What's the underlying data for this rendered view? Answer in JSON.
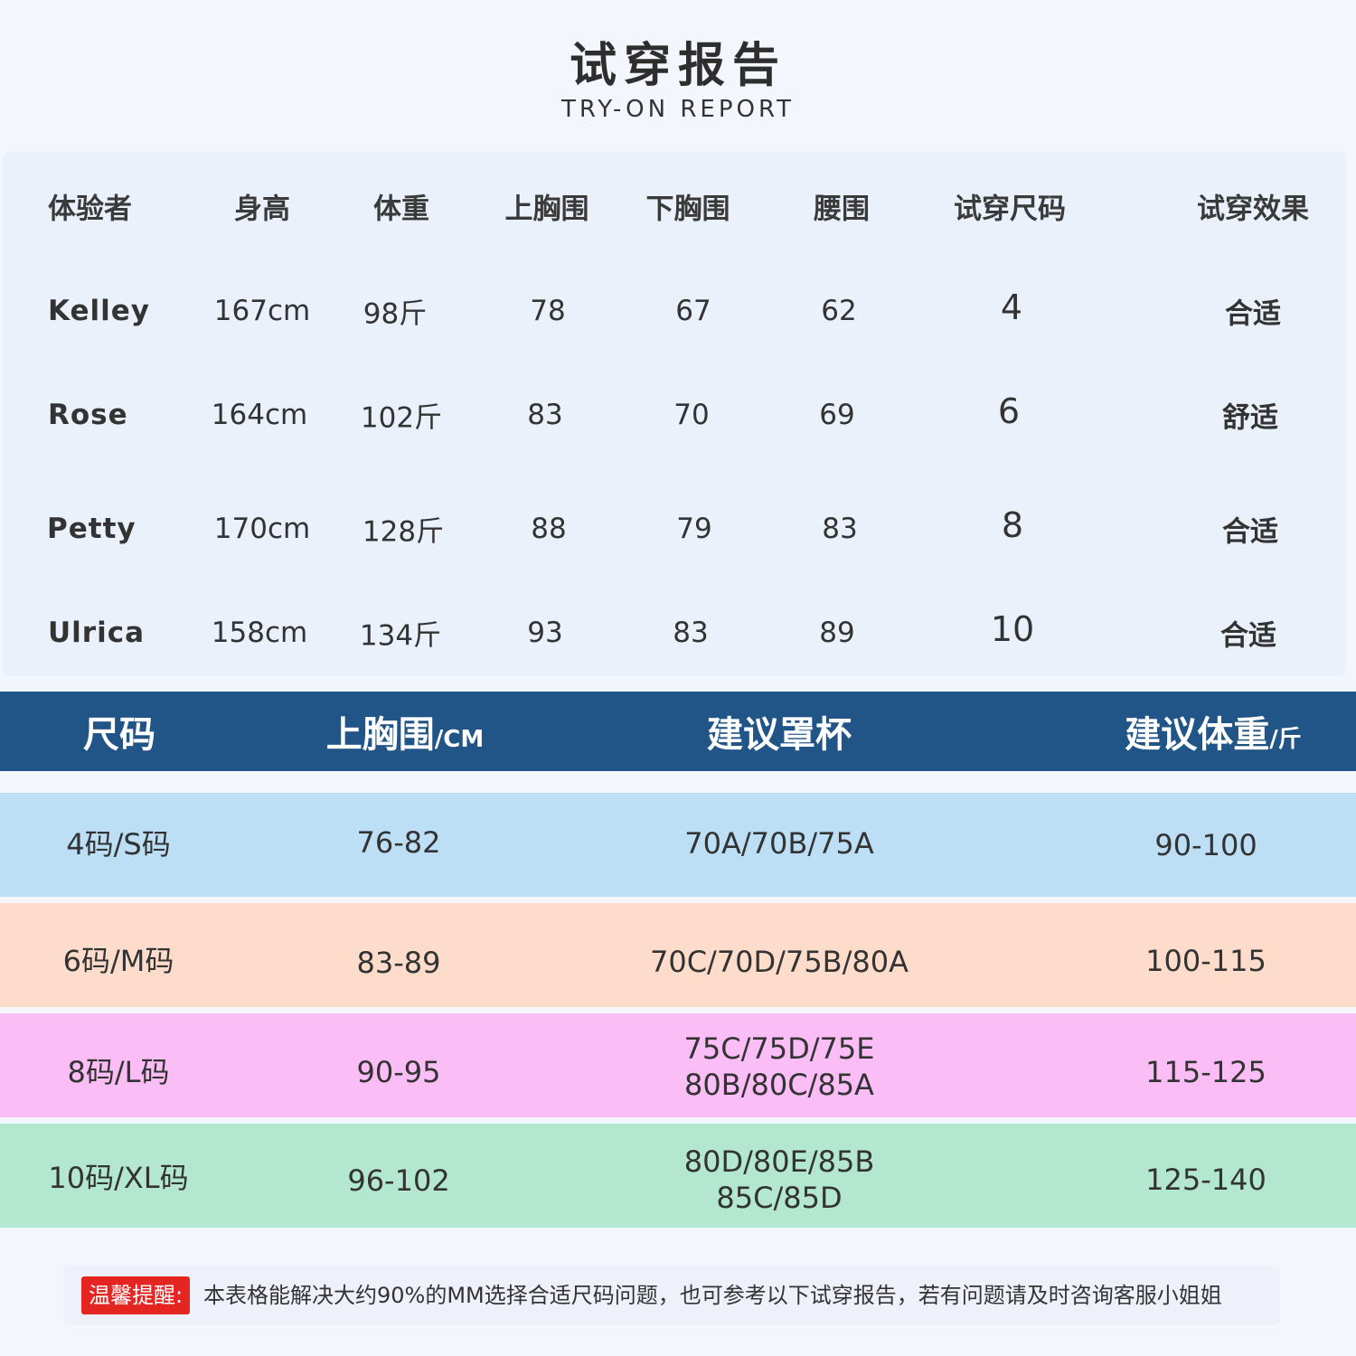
{
  "header": {
    "title_zh": "试穿报告",
    "title_en": "TRY-ON REPORT"
  },
  "tryon": {
    "columns": [
      "体验者",
      "身高",
      "体重",
      "上胸围",
      "下胸围",
      "腰围",
      "试穿尺码",
      "试穿效果"
    ],
    "rows": [
      {
        "name": "Kelley",
        "height": "167cm",
        "weight": "98斤",
        "upper_bust": "78",
        "under_bust": "67",
        "waist": "62",
        "size": "4",
        "effect": "合适"
      },
      {
        "name": "Rose",
        "height": "164cm",
        "weight": "102斤",
        "upper_bust": "83",
        "under_bust": "70",
        "waist": "69",
        "size": "6",
        "effect": "舒适"
      },
      {
        "name": "Petty",
        "height": "170cm",
        "weight": "128斤",
        "upper_bust": "88",
        "under_bust": "79",
        "waist": "83",
        "size": "8",
        "effect": "合适"
      },
      {
        "name": "Ulrica",
        "height": "158cm",
        "weight": "134斤",
        "upper_bust": "93",
        "under_bust": "83",
        "waist": "89",
        "size": "10",
        "effect": "合适"
      }
    ]
  },
  "size_chart": {
    "header": {
      "size": "尺码",
      "bust": "上胸围",
      "bust_unit": "/CM",
      "cup": "建议罩杯",
      "weight": "建议体重",
      "weight_unit": "/斤"
    },
    "rows": [
      {
        "size": "4码/S码",
        "bust": "76-82",
        "cup_line1": "70A/70B/75A",
        "cup_line2": "",
        "weight": "90-100",
        "color": "#bddff5"
      },
      {
        "size": "6码/M码",
        "bust": "83-89",
        "cup_line1": "70C/70D/75B/80A",
        "cup_line2": "",
        "weight": "100-115",
        "color": "#fddccc"
      },
      {
        "size": "8码/L码",
        "bust": "90-95",
        "cup_line1": "75C/75D/75E",
        "cup_line2": "80B/80C/85A",
        "weight": "115-125",
        "color": "#fbbdf6"
      },
      {
        "size": "10码/XL码",
        "bust": "96-102",
        "cup_line1": "80D/80E/85B",
        "cup_line2": "85C/85D",
        "weight": "125-140",
        "color": "#b3e7d0"
      }
    ]
  },
  "note": {
    "tag": "温馨提醒:",
    "text": "本表格能解决大约90%的MM选择合适尺码问题，也可参考以下试穿报告，若有问题请及时咨询客服小姐姐"
  }
}
